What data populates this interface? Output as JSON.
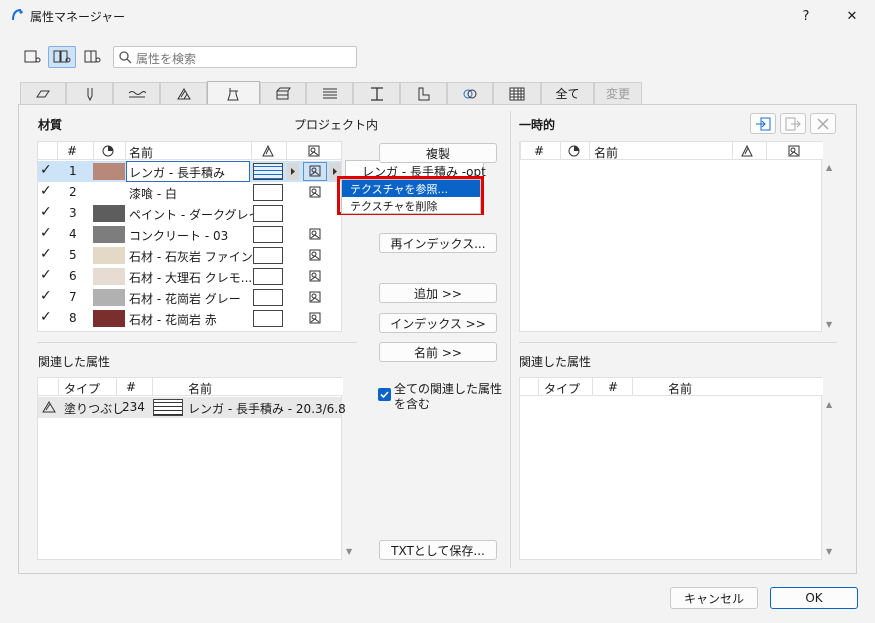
{
  "window": {
    "title": "属性マネージャー",
    "help_label": "?",
    "close_label": "✕"
  },
  "search": {
    "placeholder": "属性を検索"
  },
  "tabs": [
    {
      "label": ""
    },
    {
      "label": ""
    },
    {
      "label": ""
    },
    {
      "label": ""
    },
    {
      "label": ""
    },
    {
      "label": ""
    },
    {
      "label": ""
    },
    {
      "label": ""
    },
    {
      "label": "TXT"
    },
    {
      "label": ""
    },
    {
      "label": ""
    },
    {
      "label": "全て"
    },
    {
      "label": "変更"
    }
  ],
  "left": {
    "section_title": "材質",
    "project_label": "プロジェクト内",
    "columns": {
      "num": "#",
      "name": "名前"
    },
    "rows": [
      {
        "check": "✓",
        "num": "1",
        "color": "#b8887a",
        "name": "レンガ - 長手積み",
        "brick": true,
        "texture": true
      },
      {
        "check": "✓",
        "num": "2",
        "color": "#ffffff",
        "name": "漆喰 - 白",
        "brick": false,
        "texture": true
      },
      {
        "check": "✓",
        "num": "3",
        "color": "#5d5d5d",
        "name": "ペイント - ダークグレイ",
        "brick": false,
        "texture": false
      },
      {
        "check": "✓",
        "num": "4",
        "color": "#7d7d7d",
        "name": "コンクリート - 03",
        "brick": false,
        "texture": true
      },
      {
        "check": "✓",
        "num": "5",
        "color": "#e4d8c6",
        "name": "石材 - 石灰岩 ファイン",
        "brick": false,
        "texture": true
      },
      {
        "check": "✓",
        "num": "6",
        "color": "#e6dcd1",
        "name": "石材 - 大理石 クレモ...",
        "brick": false,
        "texture": true
      },
      {
        "check": "✓",
        "num": "7",
        "color": "#b1b1b1",
        "name": "石材 - 花崗岩 グレー",
        "brick": false,
        "texture": true
      },
      {
        "check": "✓",
        "num": "8",
        "color": "#7a2e2e",
        "name": "石材 - 花崗岩 赤",
        "brick": false,
        "texture": true
      }
    ],
    "related_title": "関連した属性",
    "related_columns": {
      "type": "タイプ",
      "num": "#",
      "name": "名前"
    },
    "related_rows": [
      {
        "type": "塗りつぶし",
        "num": "234",
        "name": "レンガ - 長手積み - 20.3/6.8"
      }
    ]
  },
  "middle": {
    "duplicate_label": "複製",
    "reindex_label": "再インデックス...",
    "add_label": "追加 >>",
    "index_label": "インデックス >>",
    "name_label": "名前 >>",
    "include_related_label_1": "全ての関連した属性",
    "include_related_label_2": "を含む",
    "include_related_checked": true,
    "save_txt_label": "TXTとして保存..."
  },
  "context": {
    "texture_name": "レンガ - 長手積み -opt",
    "browse_label": "テクスチャを参照...",
    "delete_label": "テクスチャを削除",
    "highlight_color": "#e00000"
  },
  "right": {
    "section_title": "一時的",
    "columns": {
      "num": "#",
      "name": "名前"
    },
    "related_title": "関連した属性",
    "related_columns": {
      "type": "タイプ",
      "num": "#",
      "name": "名前"
    }
  },
  "footer": {
    "cancel_label": "キャンセル",
    "ok_label": "OK"
  }
}
